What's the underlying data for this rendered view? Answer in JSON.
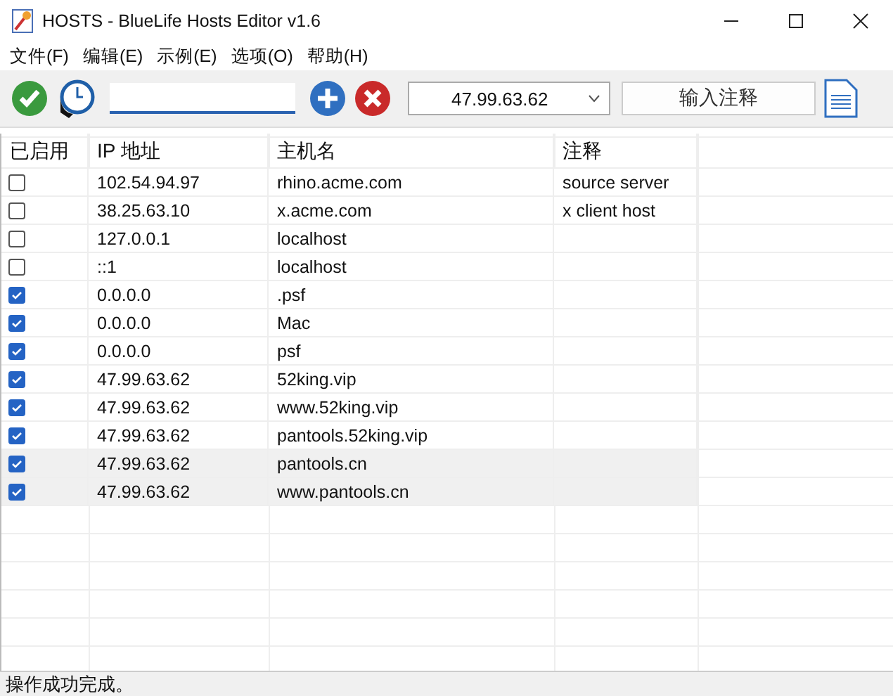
{
  "window": {
    "title": "HOSTS - BlueLife Hosts Editor v1.6"
  },
  "menu": [
    "文件(F)",
    "编辑(E)",
    "示例(E)",
    "选项(O)",
    "帮助(H)"
  ],
  "toolbar": {
    "ip_select": {
      "value": "47.99.63.62"
    },
    "comment_button": "输入注释"
  },
  "table": {
    "columns": [
      "已启用",
      "IP 地址",
      "主机名",
      "注释"
    ],
    "rows": [
      {
        "enabled": false,
        "ip": "102.54.94.97",
        "host": "rhino.acme.com",
        "comment": "source server",
        "selected": false
      },
      {
        "enabled": false,
        "ip": "38.25.63.10",
        "host": "x.acme.com",
        "comment": "x client host",
        "selected": false
      },
      {
        "enabled": false,
        "ip": "127.0.0.1",
        "host": "localhost",
        "selected": false
      },
      {
        "enabled": false,
        "ip": "::1",
        "host": "localhost",
        "selected": false
      },
      {
        "enabled": true,
        "ip": "0.0.0.0",
        "host": ".psf",
        "selected": false
      },
      {
        "enabled": true,
        "ip": "0.0.0.0",
        "host": "Mac",
        "selected": false
      },
      {
        "enabled": true,
        "ip": "0.0.0.0",
        "host": "psf",
        "selected": false
      },
      {
        "enabled": true,
        "ip": "47.99.63.62",
        "host": "52king.vip",
        "selected": false
      },
      {
        "enabled": true,
        "ip": "47.99.63.62",
        "host": "www.52king.vip",
        "selected": false
      },
      {
        "enabled": true,
        "ip": "47.99.63.62",
        "host": "pantools.52king.vip",
        "selected": false
      },
      {
        "enabled": true,
        "ip": "47.99.63.62",
        "host": "pantools.cn",
        "selected": true
      },
      {
        "enabled": true,
        "ip": "47.99.63.62",
        "host": "www.pantools.cn",
        "selected": true
      }
    ]
  },
  "status_bar": "操作成功完成。"
}
